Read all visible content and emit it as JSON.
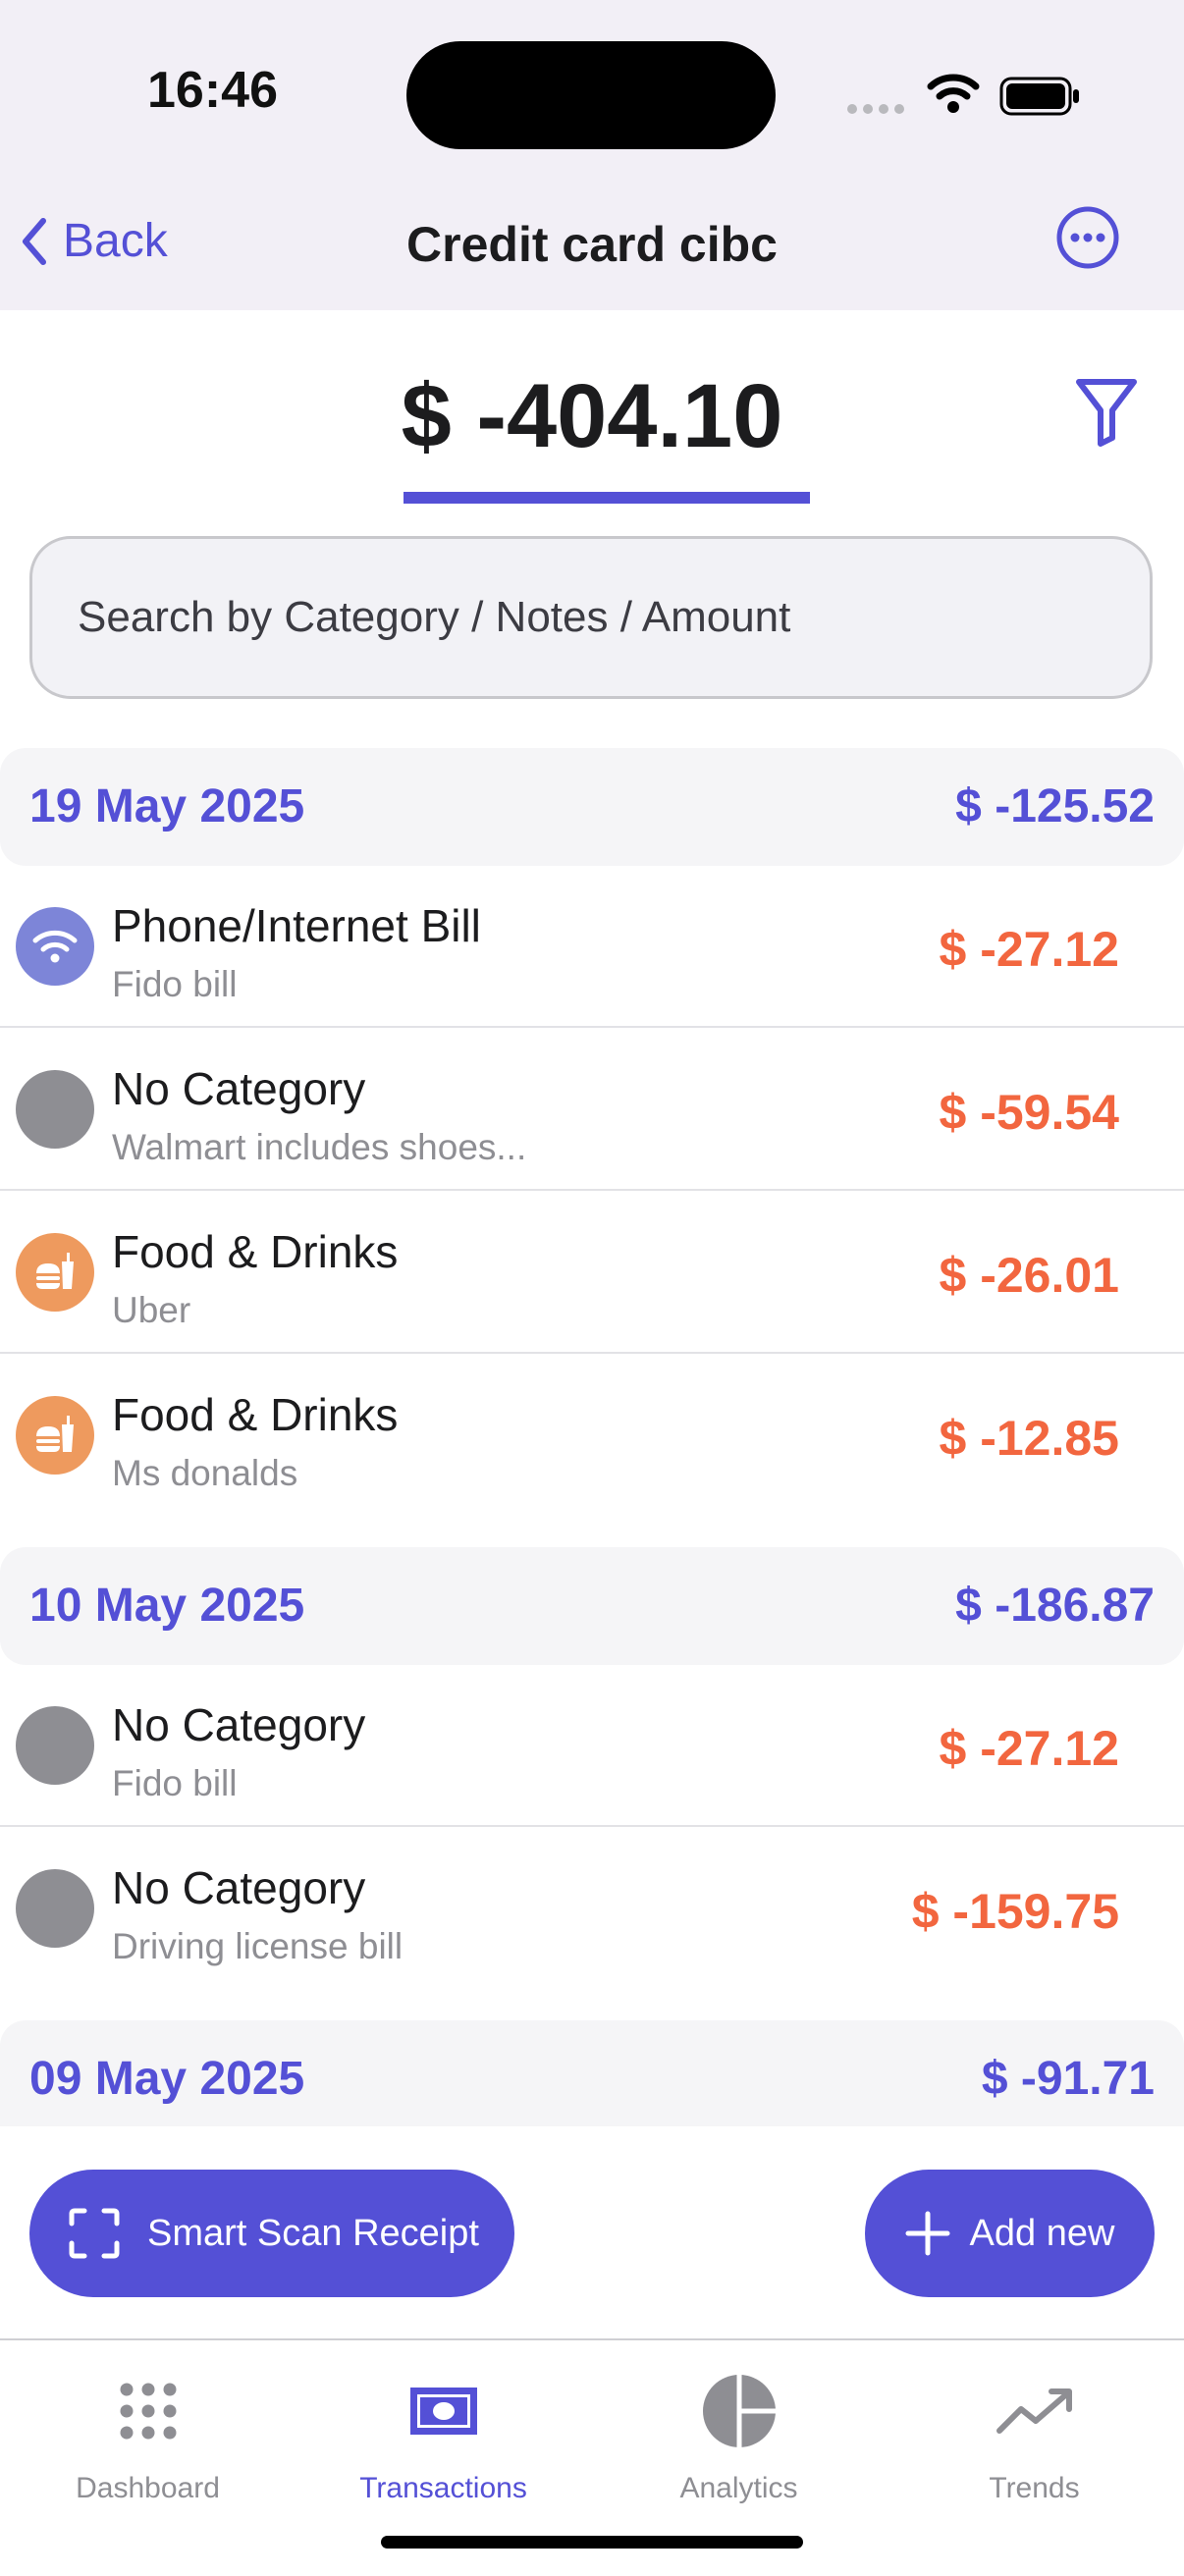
{
  "status_bar": {
    "time": "16:46"
  },
  "nav": {
    "back_label": "Back",
    "title": "Credit card cibc"
  },
  "balance": {
    "total": "$ -404.10"
  },
  "search": {
    "placeholder": "Search by Category / Notes / Amount"
  },
  "groups": [
    {
      "date": "19 May 2025",
      "total": "$ -125.52",
      "items": [
        {
          "category": "Phone/Internet Bill",
          "note": "Fido bill",
          "amount": "$ -27.12",
          "icon": "wifi-icon"
        },
        {
          "category": "No Category",
          "note": "Walmart includes shoes...",
          "amount": "$ -59.54",
          "icon": "no-category-icon"
        },
        {
          "category": "Food & Drinks",
          "note": "Uber",
          "amount": "$ -26.01",
          "icon": "food-drinks-icon"
        },
        {
          "category": "Food & Drinks",
          "note": "Ms donalds",
          "amount": "$ -12.85",
          "icon": "food-drinks-icon"
        }
      ]
    },
    {
      "date": "10 May 2025",
      "total": "$ -186.87",
      "items": [
        {
          "category": "No Category",
          "note": "Fido bill",
          "amount": "$ -27.12",
          "icon": "no-category-icon"
        },
        {
          "category": "No Category",
          "note": "Driving license bill",
          "amount": "$ -159.75",
          "icon": "no-category-icon"
        }
      ]
    },
    {
      "date": "09 May 2025",
      "total": "$ -91.71",
      "items": []
    }
  ],
  "actions": {
    "scan_label": "Smart Scan Receipt",
    "add_label": "Add new"
  },
  "tabs": [
    {
      "label": "Dashboard",
      "icon": "dashboard-grid-icon",
      "active": false
    },
    {
      "label": "Transactions",
      "icon": "banknote-icon",
      "active": true
    },
    {
      "label": "Analytics",
      "icon": "pie-chart-icon",
      "active": false
    },
    {
      "label": "Trends",
      "icon": "trend-up-icon",
      "active": false
    }
  ],
  "colors": {
    "accent": "#5450d6",
    "negative_amount": "#f2663f",
    "header_bg": "#f2eff6"
  }
}
